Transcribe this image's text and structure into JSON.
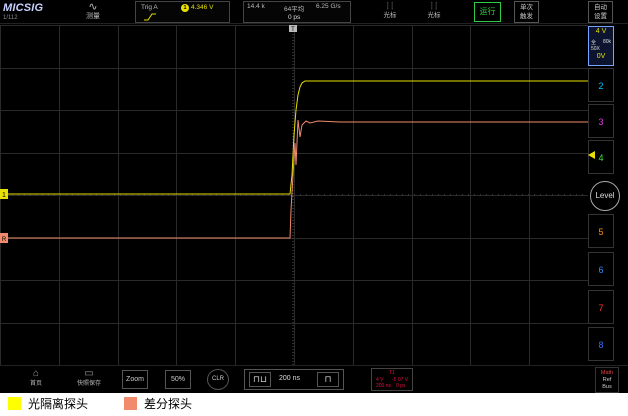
{
  "brand": {
    "logo": "MICSIG",
    "page": "1/112"
  },
  "topbar": {
    "measure_label": "测量",
    "trigger": {
      "mode": "Trig A",
      "source": "1",
      "level": "4.346 V"
    },
    "timebase": {
      "memory": "14.4 k",
      "average": "64平均",
      "sample_rate": "6.25 G/s",
      "position": "0 ps"
    },
    "cursor1_label": "光标",
    "cursor2_label": "光标",
    "run_label": "运行",
    "single_label_1": "单次",
    "single_label_2": "触发",
    "auto_label_1": "自动",
    "auto_label_2": "设置"
  },
  "channels": {
    "ch1": {
      "scale": "4 V",
      "coupling": "全",
      "bw": "80k",
      "probe_x": "50X",
      "offset": "0V"
    },
    "labels": [
      "2",
      "3",
      "4",
      "5",
      "6",
      "7",
      "8"
    ],
    "level_label": "Level",
    "ch1_marker": "1",
    "ref_marker": "R"
  },
  "bottombar": {
    "home_label": "首页",
    "save_label": "快照保存",
    "zoom_label": "Zoom",
    "fifty_label": "50%",
    "clr_label": "CLR",
    "time_per_div": "200 ns",
    "trig_status": {
      "t": "T1",
      "v1": "4 V",
      "v2": "-5.07 V",
      "t1": "200 ns",
      "t2": "0 ps"
    },
    "math": {
      "l1": "Math",
      "l2": "Ref",
      "l3": "Bus"
    }
  },
  "legend": [
    {
      "label": "光隔离探头",
      "color": "#ffff00"
    },
    {
      "label": "差分探头",
      "color": "#f28b6d"
    }
  ],
  "colors": {
    "ch1": "#e8e000",
    "ch2": "#00c8ff",
    "ch3": "#e040e0",
    "ch4": "#40e040",
    "ch5": "#ff8c1a",
    "ch6": "#2f8cff",
    "ch7": "#ff3030",
    "ch8": "#3a6bff",
    "math": "#f28b6d"
  }
}
